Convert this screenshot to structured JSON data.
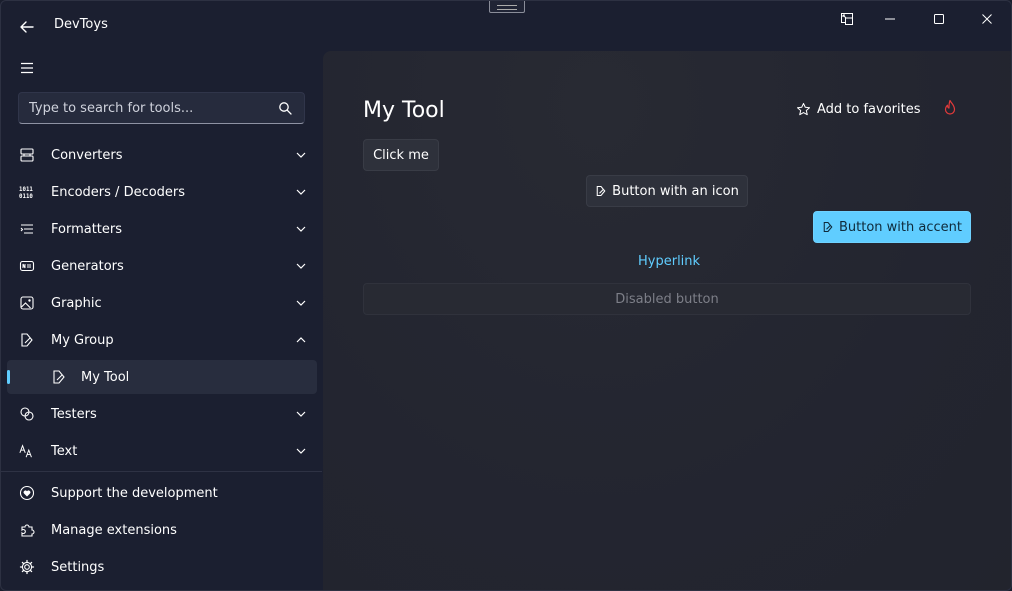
{
  "app": {
    "title": "DevToys"
  },
  "search": {
    "placeholder": "Type to search for tools..."
  },
  "sidebar": {
    "items": [
      {
        "label": "Converters",
        "icon": "converters-icon",
        "expanded": false
      },
      {
        "label": "Encoders / Decoders",
        "icon": "binary-icon",
        "icon_text": "1011 0110",
        "expanded": false
      },
      {
        "label": "Formatters",
        "icon": "formatters-icon",
        "expanded": false
      },
      {
        "label": "Generators",
        "icon": "generators-icon",
        "expanded": false
      },
      {
        "label": "Graphic",
        "icon": "image-icon",
        "expanded": false
      },
      {
        "label": "My Group",
        "icon": "pen-icon",
        "expanded": true
      },
      {
        "label": "My Tool",
        "icon": "pen-icon",
        "selected": true
      },
      {
        "label": "Testers",
        "icon": "testers-icon",
        "expanded": false
      },
      {
        "label": "Text",
        "icon": "text-icon",
        "expanded": false
      }
    ],
    "footer": [
      {
        "label": "Support the development",
        "icon": "heart-icon"
      },
      {
        "label": "Manage extensions",
        "icon": "puzzle-icon"
      },
      {
        "label": "Settings",
        "icon": "gear-icon"
      }
    ]
  },
  "main": {
    "title": "My Tool",
    "favorite_label": "Add to favorites",
    "buttons": {
      "click_me": "Click me",
      "with_icon": "Button with an icon",
      "accent": "Button with accent",
      "hyperlink": "Hyperlink",
      "disabled": "Disabled button"
    }
  },
  "colors": {
    "accent": "#60cdff",
    "sidebar_bg": "#1b1f30",
    "content_bg": "#24262f",
    "flame": "#e23a3a"
  }
}
